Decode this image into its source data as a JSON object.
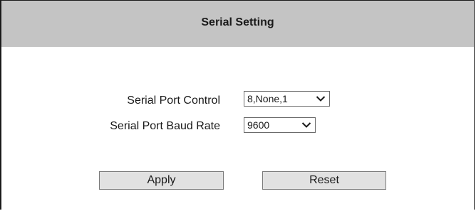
{
  "header": {
    "title": "Serial Setting"
  },
  "form": {
    "port_control": {
      "label": "Serial Port Control",
      "selected": "8,None,1"
    },
    "baud_rate": {
      "label": "Serial Port Baud Rate",
      "selected": "9600"
    }
  },
  "buttons": {
    "apply_label": "Apply",
    "reset_label": "Reset"
  },
  "icons": {
    "dropdown": "chevron-down-icon"
  },
  "colors": {
    "header_bg": "#c4c4c4",
    "button_bg": "#e1e1e1",
    "text": "#1a1a1a"
  }
}
